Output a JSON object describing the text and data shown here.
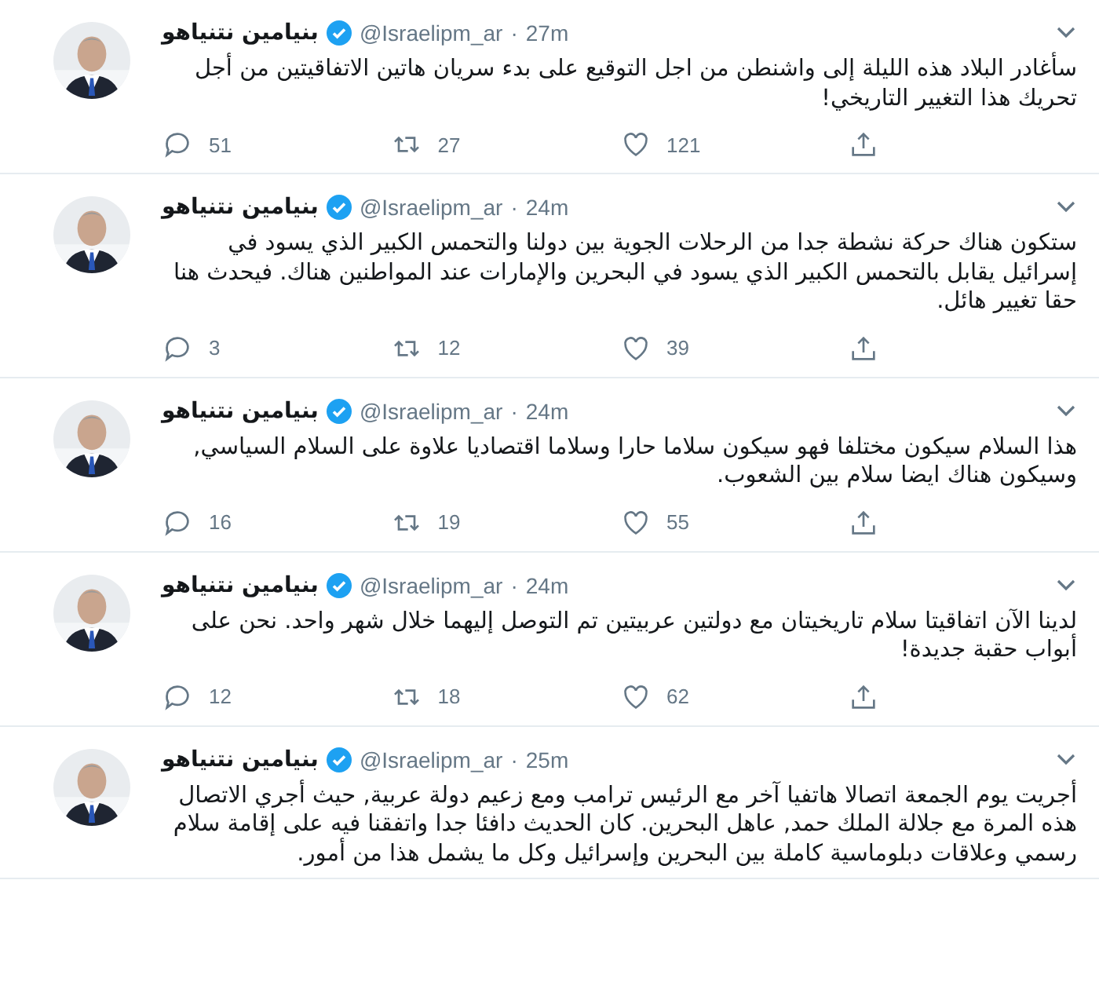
{
  "tweets": [
    {
      "name": "بنيامين نتنياهو",
      "verified": true,
      "handle": "@Israelipm_ar",
      "separator": "·",
      "time": "27m",
      "text": "سأغادر البلاد هذه الليلة إلى واشنطن من اجل التوقيع على بدء سريان هاتين الاتفاقيتين من أجل تحريك هذا التغيير التاريخي!",
      "replies": "51",
      "retweets": "27",
      "likes": "121"
    },
    {
      "name": "بنيامين نتنياهو",
      "verified": true,
      "handle": "@Israelipm_ar",
      "separator": "·",
      "time": "24m",
      "text": "ستكون هناك حركة نشطة جدا من الرحلات الجوية بين دولنا والتحمس الكبير الذي يسود في إسرائيل يقابل بالتحمس الكبير الذي يسود في البحرين والإمارات عند المواطنين هناك. فيحدث هنا حقا تغيير هائل.",
      "replies": "3",
      "retweets": "12",
      "likes": "39"
    },
    {
      "name": "بنيامين نتنياهو",
      "verified": true,
      "handle": "@Israelipm_ar",
      "separator": "·",
      "time": "24m",
      "text": "هذا السلام سيكون مختلفا فهو سيكون سلاما حارا وسلاما اقتصاديا علاوة على السلام السياسي, وسيكون هناك ايضا سلام بين الشعوب.",
      "replies": "16",
      "retweets": "19",
      "likes": "55"
    },
    {
      "name": "بنيامين نتنياهو",
      "verified": true,
      "handle": "@Israelipm_ar",
      "separator": "·",
      "time": "24m",
      "text": "لدينا الآن اتفاقيتا سلام تاريخيتان مع دولتين عربيتين تم التوصل إليهما خلال شهر واحد. نحن على أبواب حقبة جديدة!",
      "replies": "12",
      "retweets": "18",
      "likes": "62"
    },
    {
      "name": "بنيامين نتنياهو",
      "verified": true,
      "handle": "@Israelipm_ar",
      "separator": "·",
      "time": "25m",
      "text": "أجريت يوم الجمعة اتصالا هاتفيا آخر مع الرئيس ترامب ومع زعيم دولة عربية, حيث أجري الاتصال هذه المرة مع جلالة الملك حمد, عاهل البحرين. كان الحديث دافئا جدا واتفقنا فيه على إقامة سلام رسمي وعلاقات دبلوماسية كاملة بين البحرين وإسرائيل وكل ما يشمل هذا من أمور."
    }
  ]
}
